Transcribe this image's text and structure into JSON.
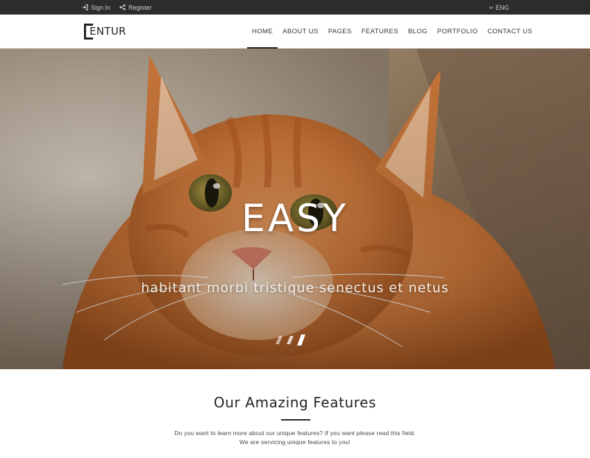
{
  "topbar": {
    "sign_in_label": "Sign In",
    "register_label": "Register",
    "language": "ENG",
    "icons": {
      "sign_in": "sign-in-icon",
      "register": "share-icon",
      "language": "chevron-down-icon"
    },
    "background_color": "#2c2c2c"
  },
  "navbar": {
    "logo_text": "ENTUR",
    "items": [
      {
        "label": "HOME",
        "active": true
      },
      {
        "label": "ABOUT US",
        "active": false
      },
      {
        "label": "PAGES",
        "active": false
      },
      {
        "label": "FEATURES",
        "active": false
      },
      {
        "label": "BLOG",
        "active": false
      },
      {
        "label": "PORTFOLIO",
        "active": false
      },
      {
        "label": "CONTACT US",
        "active": false
      }
    ]
  },
  "hero": {
    "title": "EASY",
    "subtitle": "habitant morbi tristique senectus et netus",
    "image": "orange-tabby-cat-photo",
    "scroll_icon": "scroll-down-icon"
  },
  "features": {
    "title": "Our Amazing Features",
    "description_line1": "Do you want to learn more about our unique features? If you want please read this field.",
    "description_line2": "We are servicing unique features to you!"
  }
}
